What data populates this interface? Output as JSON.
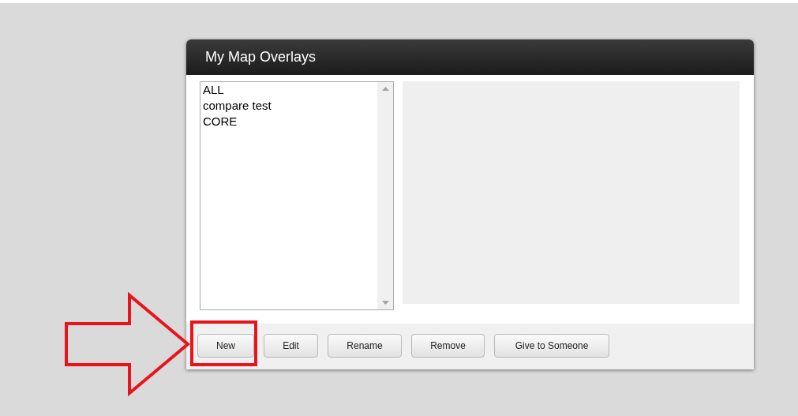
{
  "dialog": {
    "title": "My Map Overlays",
    "overlays": [
      "ALL",
      "compare test",
      "CORE"
    ],
    "buttons": [
      "New",
      "Edit",
      "Rename",
      "Remove",
      "Give to Someone"
    ]
  }
}
